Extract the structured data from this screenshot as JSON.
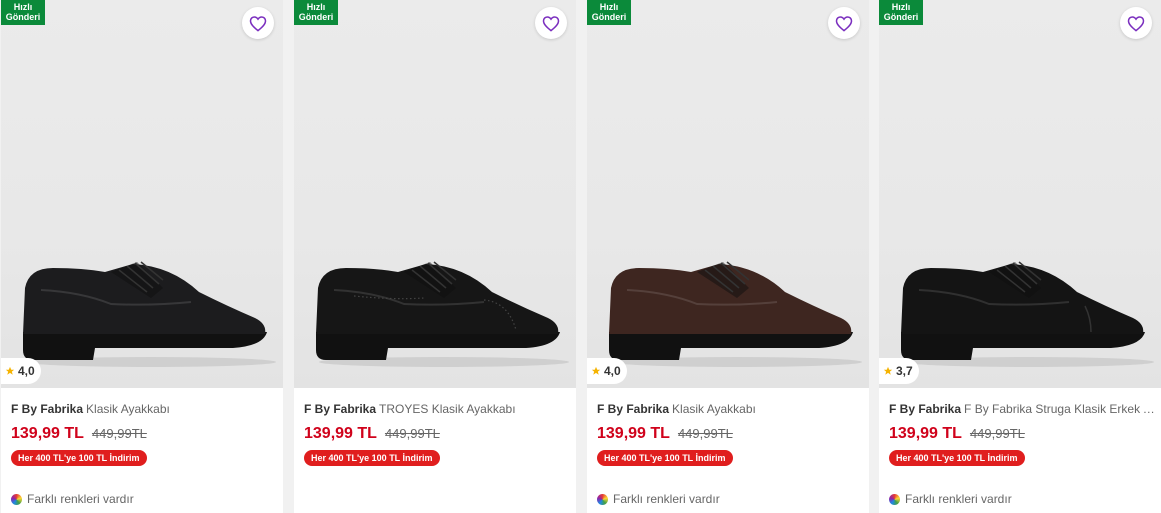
{
  "theme": {
    "price_color": "#d0021b",
    "badge_color": "#0b8a3a",
    "promo_color": "#e01e1e",
    "fav_color": "#7b2fbf"
  },
  "products": [
    {
      "fast_label": "Hızlı Gönderi",
      "rating": "4,0",
      "brand": "F By Fabrika",
      "name": "Klasik Ayakkabı",
      "price": "139,99 TL",
      "old_price": "449,99TL",
      "promo": "Her 400 TL'ye 100 TL İndirim",
      "colors_note": "Farklı renkleri vardır",
      "shoe_color": "#1c1c1e",
      "style": "plain"
    },
    {
      "fast_label": "Hızlı Gönderi",
      "rating": "",
      "brand": "F By Fabrika",
      "name": "TROYES Klasik Ayakkabı",
      "price": "139,99 TL",
      "old_price": "449,99TL",
      "promo": "Her 400 TL'ye 100 TL İndirim",
      "colors_note": "",
      "shoe_color": "#161616",
      "style": "brogue"
    },
    {
      "fast_label": "Hızlı Gönderi",
      "rating": "4,0",
      "brand": "F By Fabrika",
      "name": "Klasik Ayakkabı",
      "price": "139,99 TL",
      "old_price": "449,99TL",
      "promo": "Her 400 TL'ye 100 TL İndirim",
      "colors_note": "Farklı renkleri vardır",
      "shoe_color": "#3e2620",
      "style": "plain"
    },
    {
      "fast_label": "Hızlı Gönderi",
      "rating": "3,7",
      "brand": "F By Fabrika",
      "name": "F By Fabrika Struga Klasik Erkek Ayakkabı",
      "price": "139,99 TL",
      "old_price": "449,99TL",
      "promo": "Her 400 TL'ye 100 TL İndirim",
      "colors_note": "Farklı renkleri vardır",
      "shoe_color": "#141414",
      "style": "captoe"
    }
  ]
}
